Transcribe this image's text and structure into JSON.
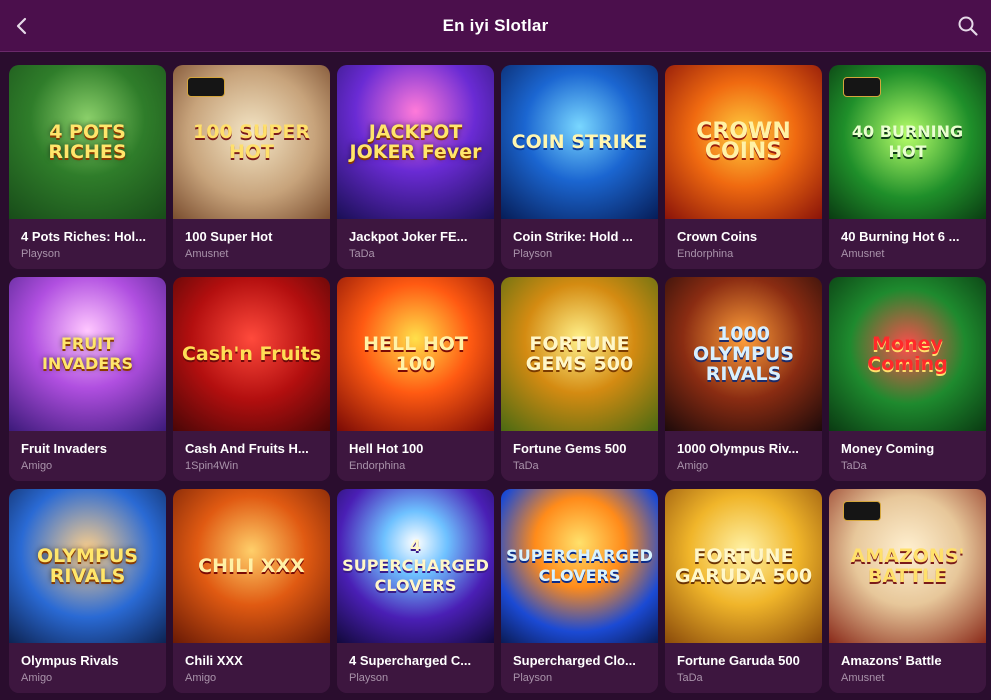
{
  "header": {
    "title": "En iyi Slotlar"
  },
  "colors": {
    "accent": "#4b0f4c",
    "card_bg": "#3d163f"
  },
  "icons": {
    "back": "chevron-left-icon",
    "search": "search-icon"
  },
  "games": [
    {
      "name": "4 Pots Riches: Hol...",
      "provider": "Playson",
      "art_text": "4 POTS RICHES"
    },
    {
      "name": "100 Super Hot",
      "provider": "Amusnet",
      "art_text": "100 SUPER HOT"
    },
    {
      "name": "Jackpot Joker FE...",
      "provider": "TaDa",
      "art_text": "JACKPOT JOKER Fever"
    },
    {
      "name": "Coin Strike: Hold ...",
      "provider": "Playson",
      "art_text": "COIN STRIKE"
    },
    {
      "name": "Crown Coins",
      "provider": "Endorphina",
      "art_text": "CROWN COINS"
    },
    {
      "name": "40 Burning Hot 6 ...",
      "provider": "Amusnet",
      "art_text": "40 BURNING HOT"
    },
    {
      "name": "Fruit Invaders",
      "provider": "Amigo",
      "art_text": "FRUIT INVADERS"
    },
    {
      "name": "Cash And Fruits H...",
      "provider": "1Spin4Win",
      "art_text": "Cash'n Fruits"
    },
    {
      "name": "Hell Hot 100",
      "provider": "Endorphina",
      "art_text": "HELL HOT 100"
    },
    {
      "name": "Fortune Gems 500",
      "provider": "TaDa",
      "art_text": "FORTUNE GEMS 500"
    },
    {
      "name": "1000 Olympus Riv...",
      "provider": "Amigo",
      "art_text": "1000 OLYMPUS RIVALS"
    },
    {
      "name": "Money Coming",
      "provider": "TaDa",
      "art_text": "Money Coming"
    },
    {
      "name": "Olympus Rivals",
      "provider": "Amigo",
      "art_text": "OLYMPUS RIVALS"
    },
    {
      "name": "Chili XXX",
      "provider": "Amigo",
      "art_text": "CHILI XXX"
    },
    {
      "name": "4 Supercharged C...",
      "provider": "Playson",
      "art_text": "4 SUPERCHARGED CLOVERS"
    },
    {
      "name": "Supercharged Clo...",
      "provider": "Playson",
      "art_text": "SUPERCHARGED CLOVERS"
    },
    {
      "name": "Fortune Garuda 500",
      "provider": "TaDa",
      "art_text": "FORTUNE GARUDA 500"
    },
    {
      "name": "Amazons' Battle",
      "provider": "Amusnet",
      "art_text": "AMAZONS' BATTLE"
    }
  ]
}
